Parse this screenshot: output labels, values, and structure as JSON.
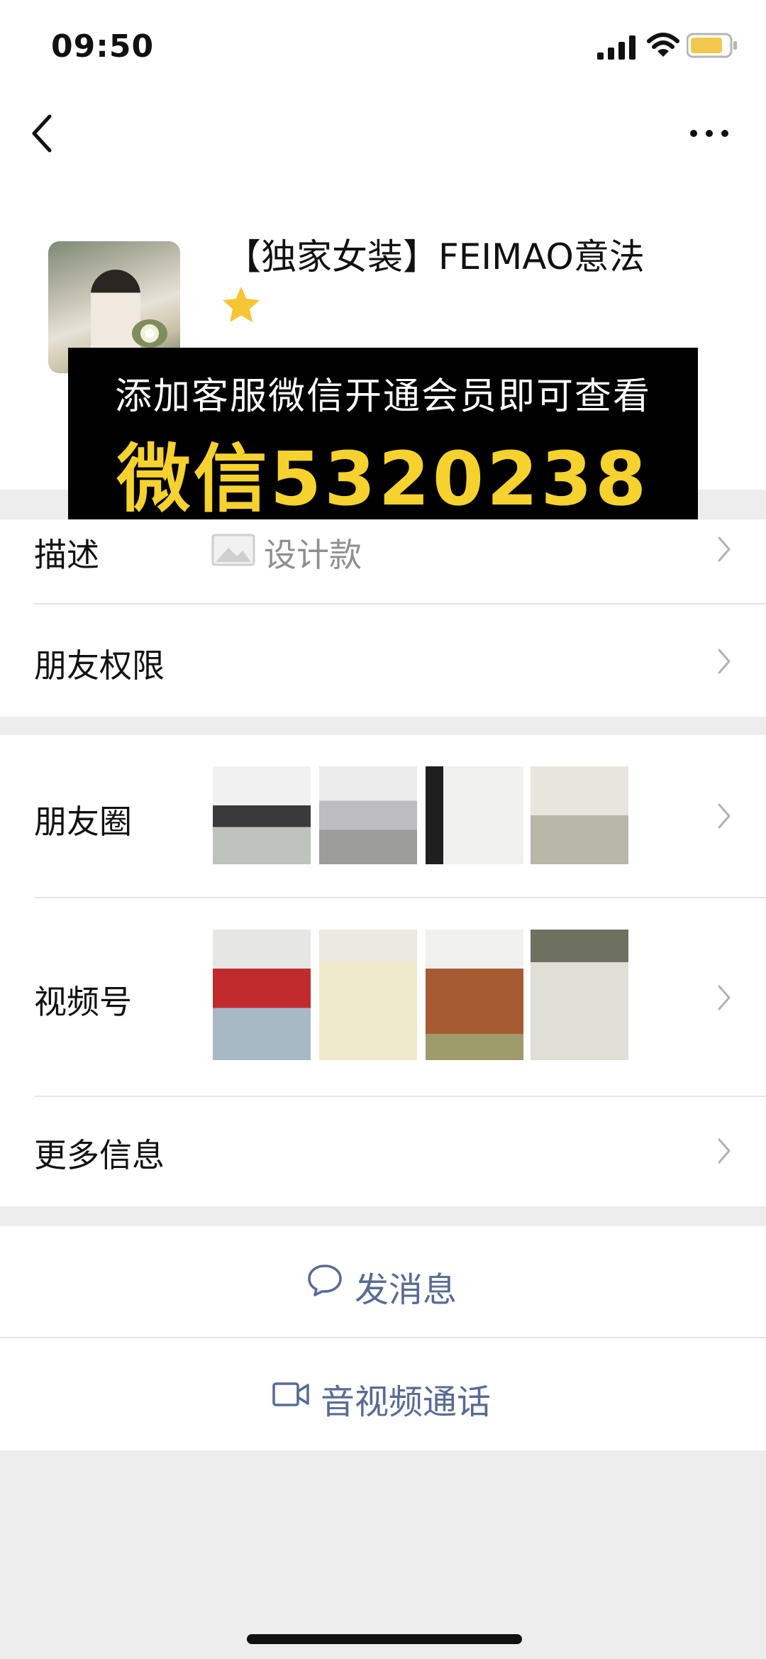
{
  "status_bar": {
    "time": "09:50",
    "icons": [
      "signal-icon",
      "wifi-icon",
      "battery-icon"
    ]
  },
  "nav": {
    "back_icon": "chevron-left-icon",
    "more_icon": "more-icon"
  },
  "profile": {
    "name": "【独家女装】FEIMAO意法",
    "star_icon": "star-icon",
    "star_color": "#f5c533"
  },
  "banner": {
    "line1": "添加客服微信开通会员即可查看",
    "line2": "微信5320238",
    "line2_color": "#f6d22f"
  },
  "rows": {
    "description": {
      "label": "描述",
      "value": "设计款"
    },
    "friend_permissions": {
      "label": "朋友权限"
    },
    "moments": {
      "label": "朋友圈",
      "thumb_count": 4
    },
    "channels": {
      "label": "视频号",
      "thumb_count": 4
    },
    "more_info": {
      "label": "更多信息"
    }
  },
  "actions": {
    "message": {
      "label": "发消息",
      "icon": "chat-bubble-icon"
    },
    "call": {
      "label": "音视频通话",
      "icon": "video-camera-icon"
    }
  },
  "colors": {
    "link": "#576b95",
    "background": "#ededed"
  }
}
